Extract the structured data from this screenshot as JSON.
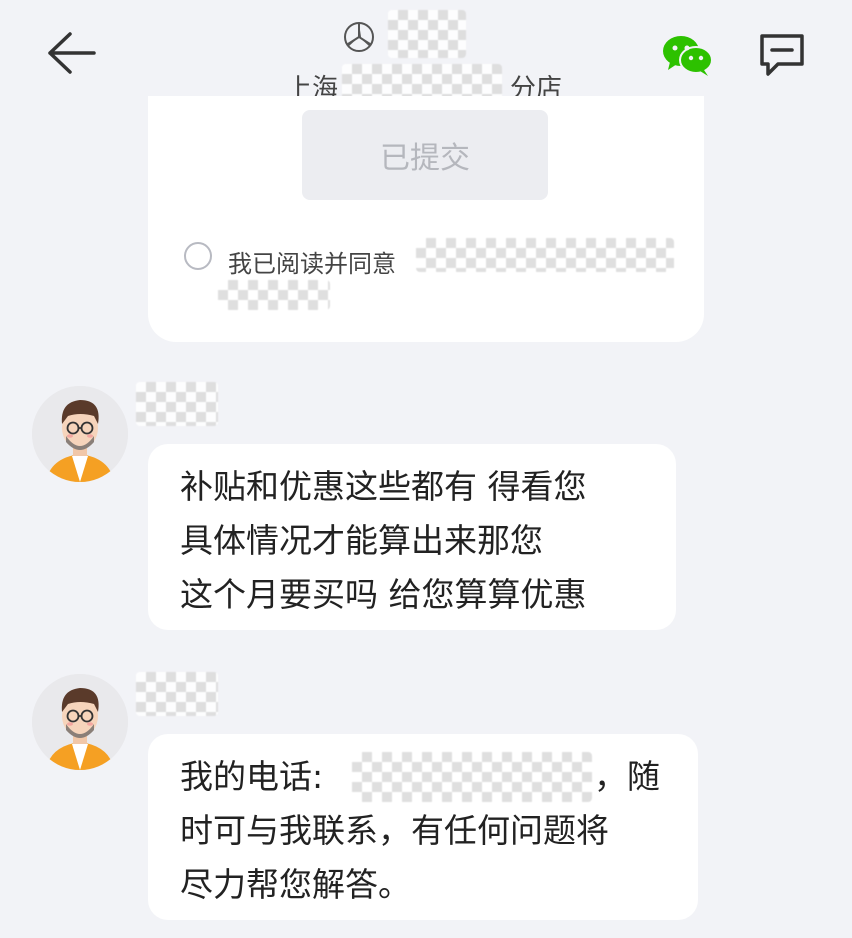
{
  "header": {
    "subtitle_prefix": "上海",
    "subtitle_suffix": "分店",
    "icons": {
      "back": "arrow-left-icon",
      "brand": "mercedes-logo-icon",
      "wechat": "wechat-icon",
      "chat": "message-square-icon"
    },
    "wechat_color": "#2DC100"
  },
  "form": {
    "submit_label": "已提交",
    "agree_text": "我已阅读并同意"
  },
  "messages": [
    {
      "lines": [
        "补贴和优惠这些都有  得看您",
        "具体情况才能算出来那您",
        "这个月要买吗 给您算算优惠"
      ]
    },
    {
      "line1_prefix": "我的电话:",
      "line1_suffix": "，随",
      "lines": [
        "时可与我联系，有任何问题将",
        "尽力帮您解答。"
      ]
    }
  ],
  "colors": {
    "background": "#F2F3F7",
    "bubble": "#FFFFFF",
    "disabled_button": "#ECEDF1",
    "avatar_shirt": "#F5A023"
  }
}
